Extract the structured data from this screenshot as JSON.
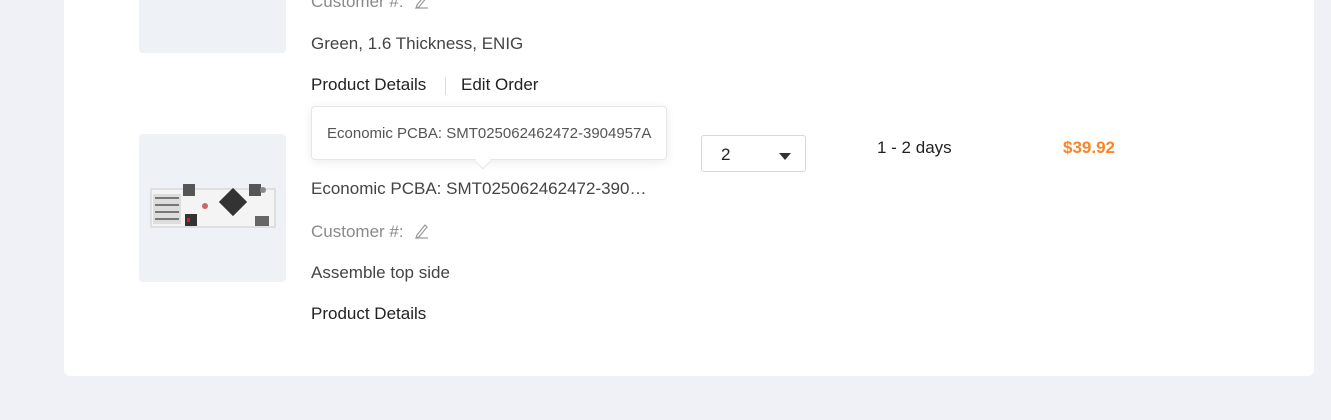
{
  "order_item_1": {
    "customer_label": "Customer #:",
    "specs": "Green, 1.6 Thickness, ENIG",
    "product_details_label": "Product Details",
    "edit_order_label": "Edit Order"
  },
  "order_item_2": {
    "tooltip_text": "Economic PCBA: SMT025062462472-3904957A",
    "title": "Economic PCBA: SMT025062462472-390…",
    "customer_label": "Customer #:",
    "specs": "Assemble top side",
    "product_details_label": "Product Details",
    "quantity": "2",
    "lead_time": "1 - 2 days",
    "price": "$39.92"
  },
  "colors": {
    "price": "#f5862a",
    "background": "#eff1f6"
  },
  "icons": {
    "customer_edit": "pencil-icon",
    "quantity_dropdown": "caret-down-icon"
  }
}
